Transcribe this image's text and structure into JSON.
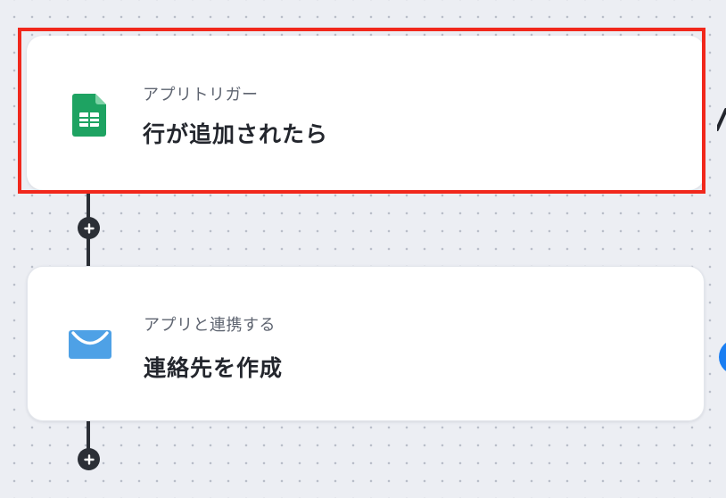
{
  "flow": {
    "steps": [
      {
        "subtitle": "アプリトリガー",
        "title": "行が追加されたら",
        "app_icon": "google-sheets-icon",
        "selected": true
      },
      {
        "subtitle": "アプリと連携する",
        "title": "連絡先を作成",
        "app_icon": "mail-envelope-icon",
        "selected": false
      }
    ]
  },
  "colors": {
    "selection_outline": "#f1281c",
    "connector": "#2b2f36",
    "sheets_green": "#1ea362",
    "mail_blue": "#4ea1e6",
    "accent_blue": "#1a7ef2"
  },
  "icons": {
    "add_step": "plus-icon",
    "edge_right_top": "arrow-icon",
    "edge_right_bottom": "blue-circle-icon"
  }
}
